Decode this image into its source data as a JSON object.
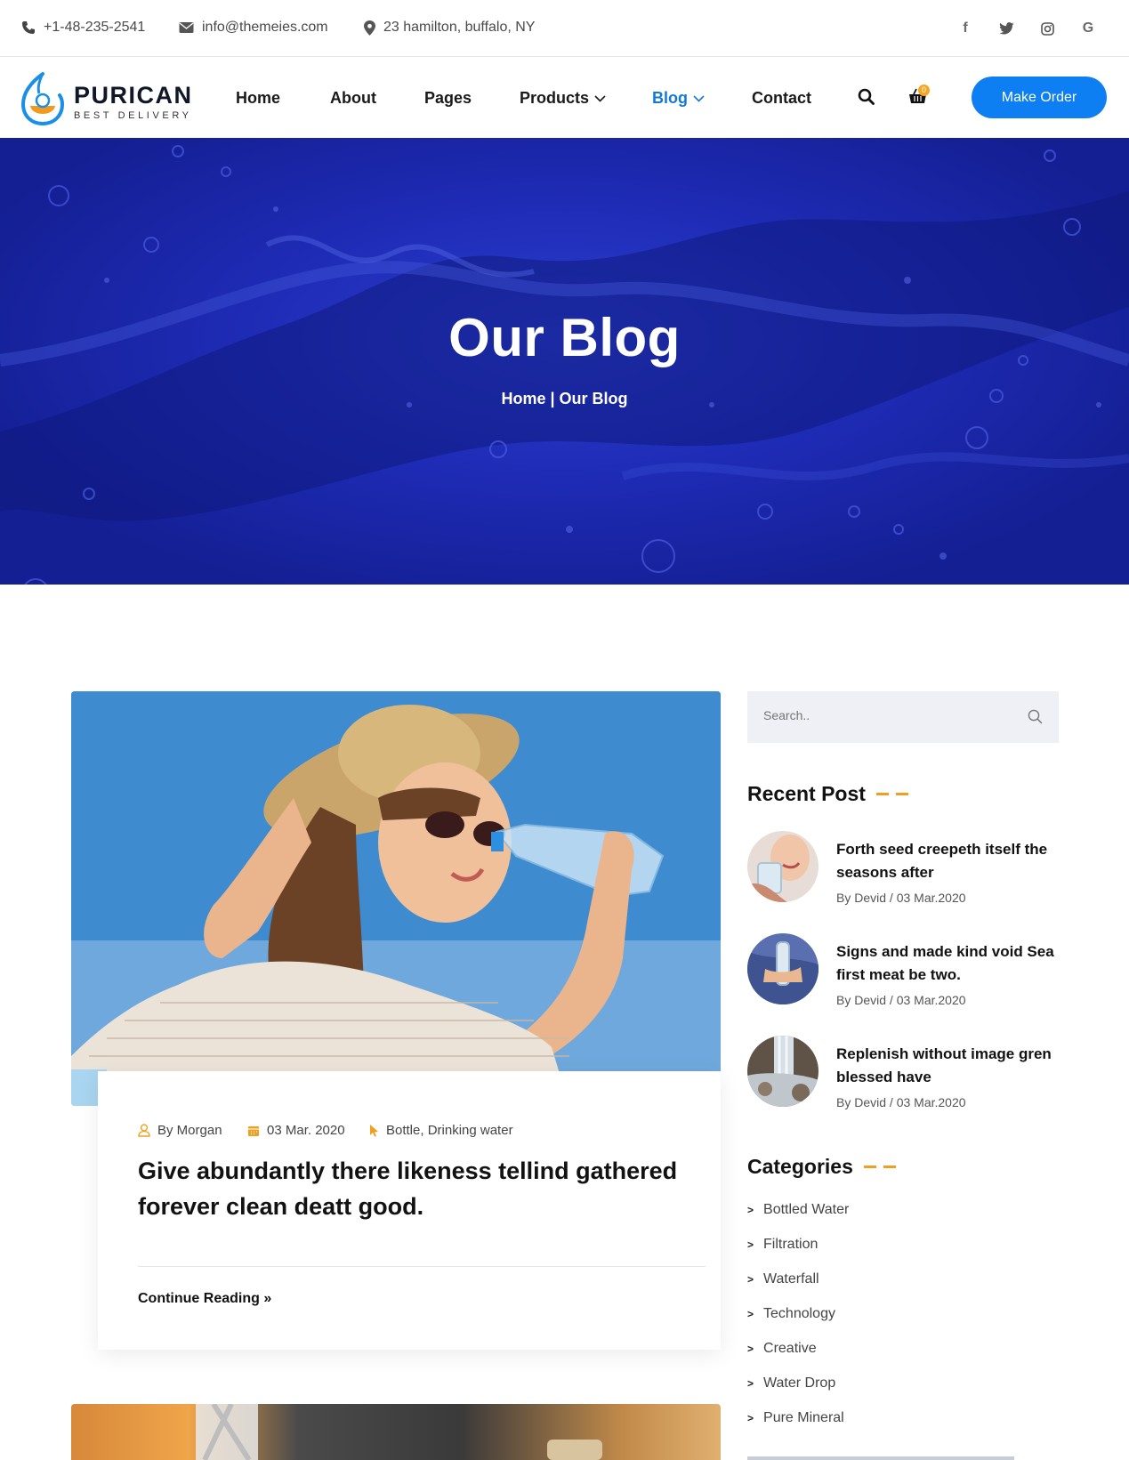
{
  "topbar": {
    "phone": "+1-48-235-2541",
    "email": "info@themeies.com",
    "address": "23 hamilton, buffalo, NY",
    "socials": [
      "facebook-icon",
      "twitter-icon",
      "instagram-icon",
      "google-icon"
    ],
    "social_glyphs": [
      "f",
      "t",
      "◎",
      "G"
    ]
  },
  "header": {
    "brand": "PURICAN",
    "tagline": "BEST DELIVERY",
    "nav": [
      "Home",
      "About",
      "Pages",
      "Products",
      "Blog",
      "Contact"
    ],
    "active_nav": "Blog",
    "cart_count": "0",
    "cta": "Make Order"
  },
  "hero": {
    "title": "Our Blog",
    "breadcrumb_home": "Home",
    "breadcrumb_sep": " | ",
    "breadcrumb_current": "Our Blog"
  },
  "post": {
    "author": "By Morgan",
    "date": "03 Mar. 2020",
    "tags": "Bottle, Drinking water",
    "title": "Give abundantly there likeness tellind gathered forever clean deatt good.",
    "continue": "Continue Reading »"
  },
  "sidebar": {
    "search_placeholder": "Search..",
    "recent_title": "Recent Post",
    "recent": [
      {
        "title": "Forth seed creepeth itself the seasons after",
        "meta": "By Devid / 03 Mar.2020"
      },
      {
        "title": "Signs and made kind void Sea first meat be two.",
        "meta": "By Devid / 03 Mar.2020"
      },
      {
        "title": "Replenish without image gren blessed have",
        "meta": "By Devid / 03 Mar.2020"
      }
    ],
    "categories_title": "Categories",
    "categories": [
      "Bottled Water",
      "Filtration",
      "Waterfall",
      "Technology",
      "Creative",
      "Water Drop",
      "Pure Mineral"
    ]
  },
  "colors": {
    "accent": "#0d7ff2",
    "active_nav": "#1479d6",
    "highlight": "#f0a020",
    "hero": "#1e2bb5"
  }
}
